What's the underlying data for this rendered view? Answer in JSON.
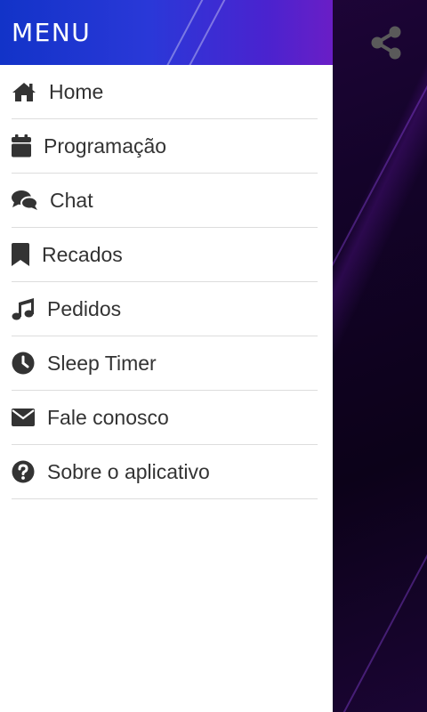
{
  "drawer": {
    "title": "MENU",
    "items": [
      {
        "label": "Home",
        "icon": "home-icon"
      },
      {
        "label": "Programação",
        "icon": "calendar-icon"
      },
      {
        "label": "Chat",
        "icon": "chat-bubbles-icon"
      },
      {
        "label": "Recados",
        "icon": "bookmark-icon"
      },
      {
        "label": "Pedidos",
        "icon": "music-note-icon"
      },
      {
        "label": "Sleep Timer",
        "icon": "clock-icon"
      },
      {
        "label": "Fale conosco",
        "icon": "envelope-icon"
      },
      {
        "label": "Sobre o aplicativo",
        "icon": "question-circle-icon"
      }
    ]
  },
  "background": {
    "share_icon": "share-icon"
  },
  "colors": {
    "header_gradient_start": "#1233c8",
    "header_gradient_end": "#6a1ec6",
    "drawer_bg": "#ffffff",
    "menu_text": "#333333",
    "divider": "#dddddd",
    "app_bg": "#14032a"
  }
}
